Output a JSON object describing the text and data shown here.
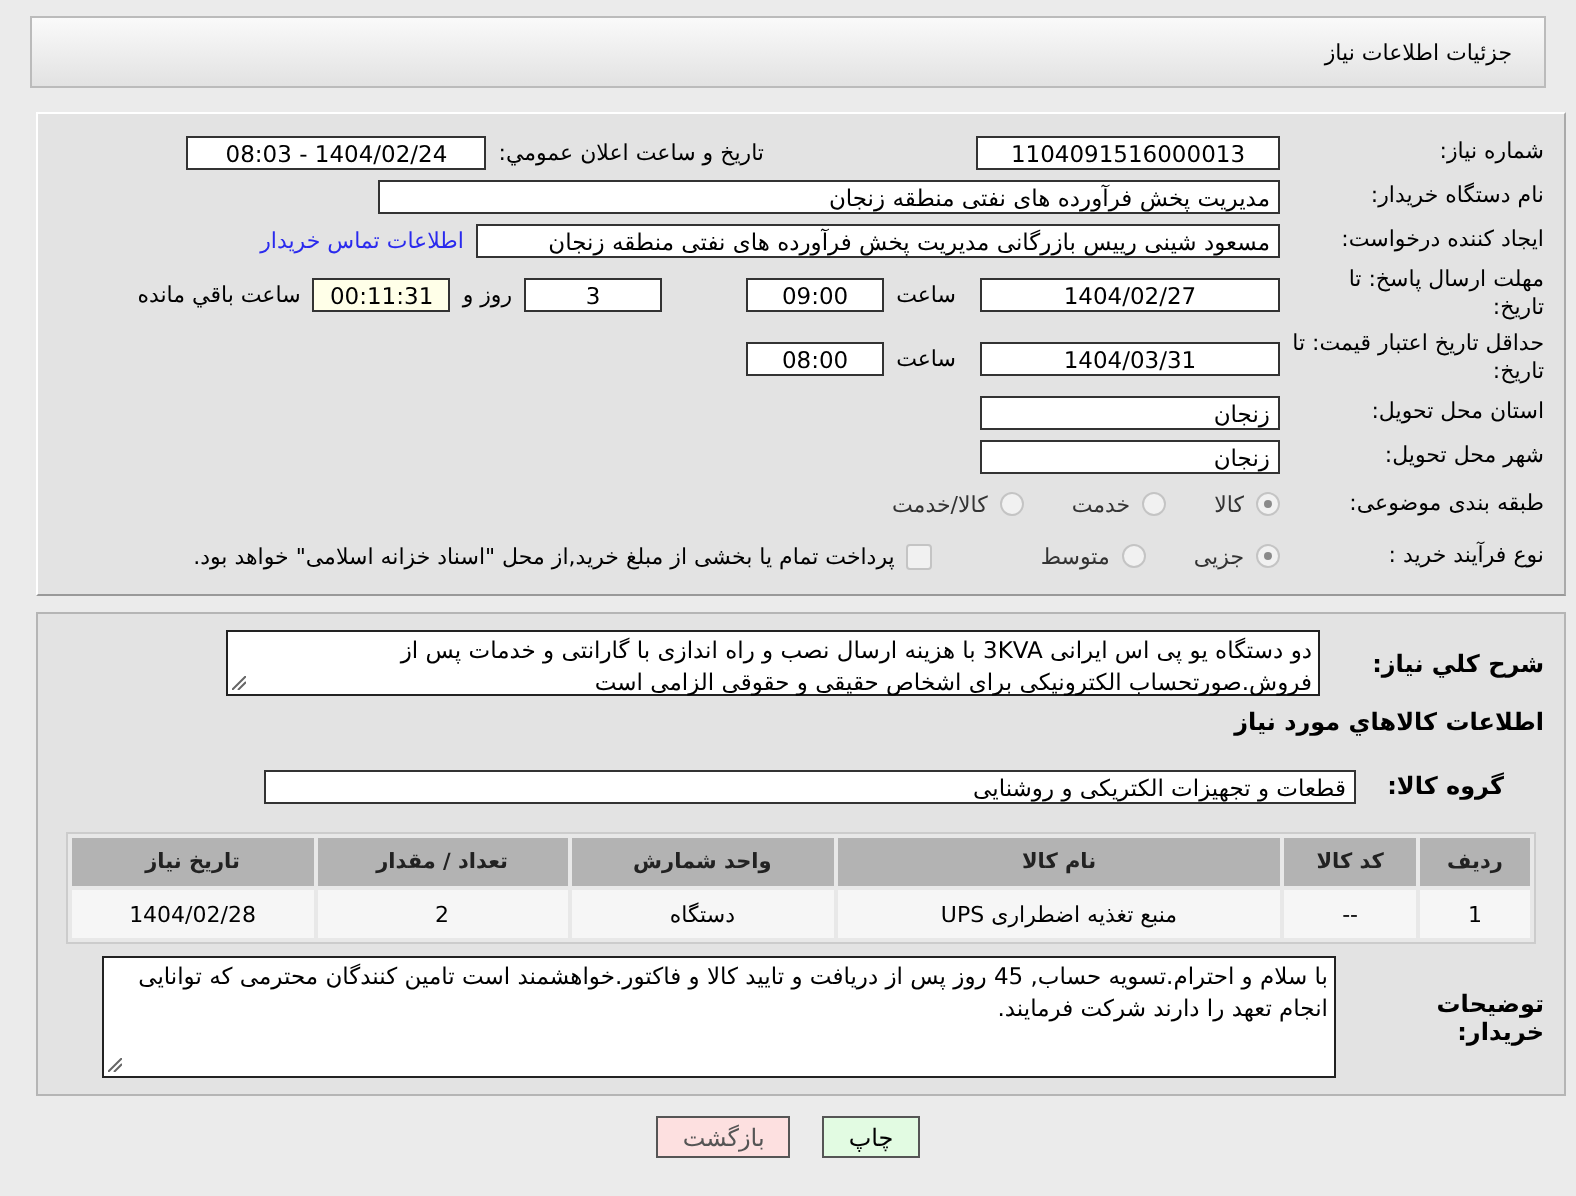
{
  "header": {
    "title": "جزئیات اطلاعات نیاز"
  },
  "form": {
    "need_number": {
      "label": "شماره نیاز:",
      "value": "1104091516000013"
    },
    "announce": {
      "label": "تاریخ و ساعت اعلان عمومي:",
      "value": "1404/02/24 - 08:03"
    },
    "buyer_org": {
      "label": "نام دستگاه خریدار:",
      "value": "مدیریت پخش فرآورده های نفتی منطقه زنجان"
    },
    "requester": {
      "label": "ایجاد کننده درخواست:",
      "value": "مسعود شینی رییس بازرگانی مدیریت پخش فرآورده های نفتی منطقه زنجان",
      "link": "اطلاعات تماس خریدار"
    },
    "reply_deadline": {
      "label": "مهلت ارسال پاسخ: تا تاریخ:",
      "date": "1404/02/27",
      "time_label": "ساعت",
      "time": "09:00",
      "days": "3",
      "days_label": "روز و",
      "remaining": "00:11:31",
      "remaining_label": "ساعت باقي مانده"
    },
    "price_validity": {
      "label": "حداقل تاریخ اعتبار قیمت: تا تاریخ:",
      "date": "1404/03/31",
      "time_label": "ساعت",
      "time": "08:00"
    },
    "province": {
      "label": "استان محل تحویل:",
      "value": "زنجان"
    },
    "city": {
      "label": "شهر محل تحویل:",
      "value": "زنجان"
    },
    "category": {
      "label": "طبقه بندی موضوعی:",
      "options": [
        {
          "label": "کالا",
          "selected": true
        },
        {
          "label": "خدمت",
          "selected": false
        },
        {
          "label": "کالا/خدمت",
          "selected": false
        }
      ]
    },
    "process": {
      "label": "نوع فرآیند خرید :",
      "options": [
        {
          "label": "جزیی",
          "selected": true
        },
        {
          "label": "متوسط",
          "selected": false
        }
      ],
      "treasury": {
        "label": "پرداخت تمام یا بخشی از مبلغ خرید,از محل \"اسناد خزانه اسلامی\" خواهد بود.",
        "checked": false
      }
    }
  },
  "description": {
    "label": "شرح کلي نیاز:",
    "value": "دو دستگاه یو پی اس  ایرانی 3KVA با هزینه ارسال نصب و راه اندازی با گارانتی و خدمات پس از فروش.صورتحساب الکترونیکی برای اشخاص حقیقی و حقوقی الزامی است"
  },
  "items_title": "اطلاعات کالاهاي مورد نیاز",
  "group": {
    "label": "گروه کالا:",
    "value": "قطعات و تجهیزات الکتریکی و روشنایی"
  },
  "table": {
    "columns": [
      "ردیف",
      "کد کالا",
      "نام کالا",
      "واحد شمارش",
      "تعداد / مقدار",
      "تاریخ نیاز"
    ],
    "rows": [
      [
        "1",
        "--",
        "منبع تغذیه اضطراری UPS",
        "دستگاه",
        "2",
        "1404/02/28"
      ]
    ]
  },
  "buyer_notes": {
    "label": "توضیحات خریدار:",
    "value": "با سلام و احترام.تسویه حساب, 45 روز پس از دریافت و تایید کالا و فاکتور.خواهشمند است تامین کنندگان محترمی که توانایی انجام تعهد را دارند شرکت فرمایند."
  },
  "buttons": [
    {
      "label": "چاپ",
      "kind": "print"
    },
    {
      "label": "بازگشت",
      "kind": "back"
    }
  ]
}
